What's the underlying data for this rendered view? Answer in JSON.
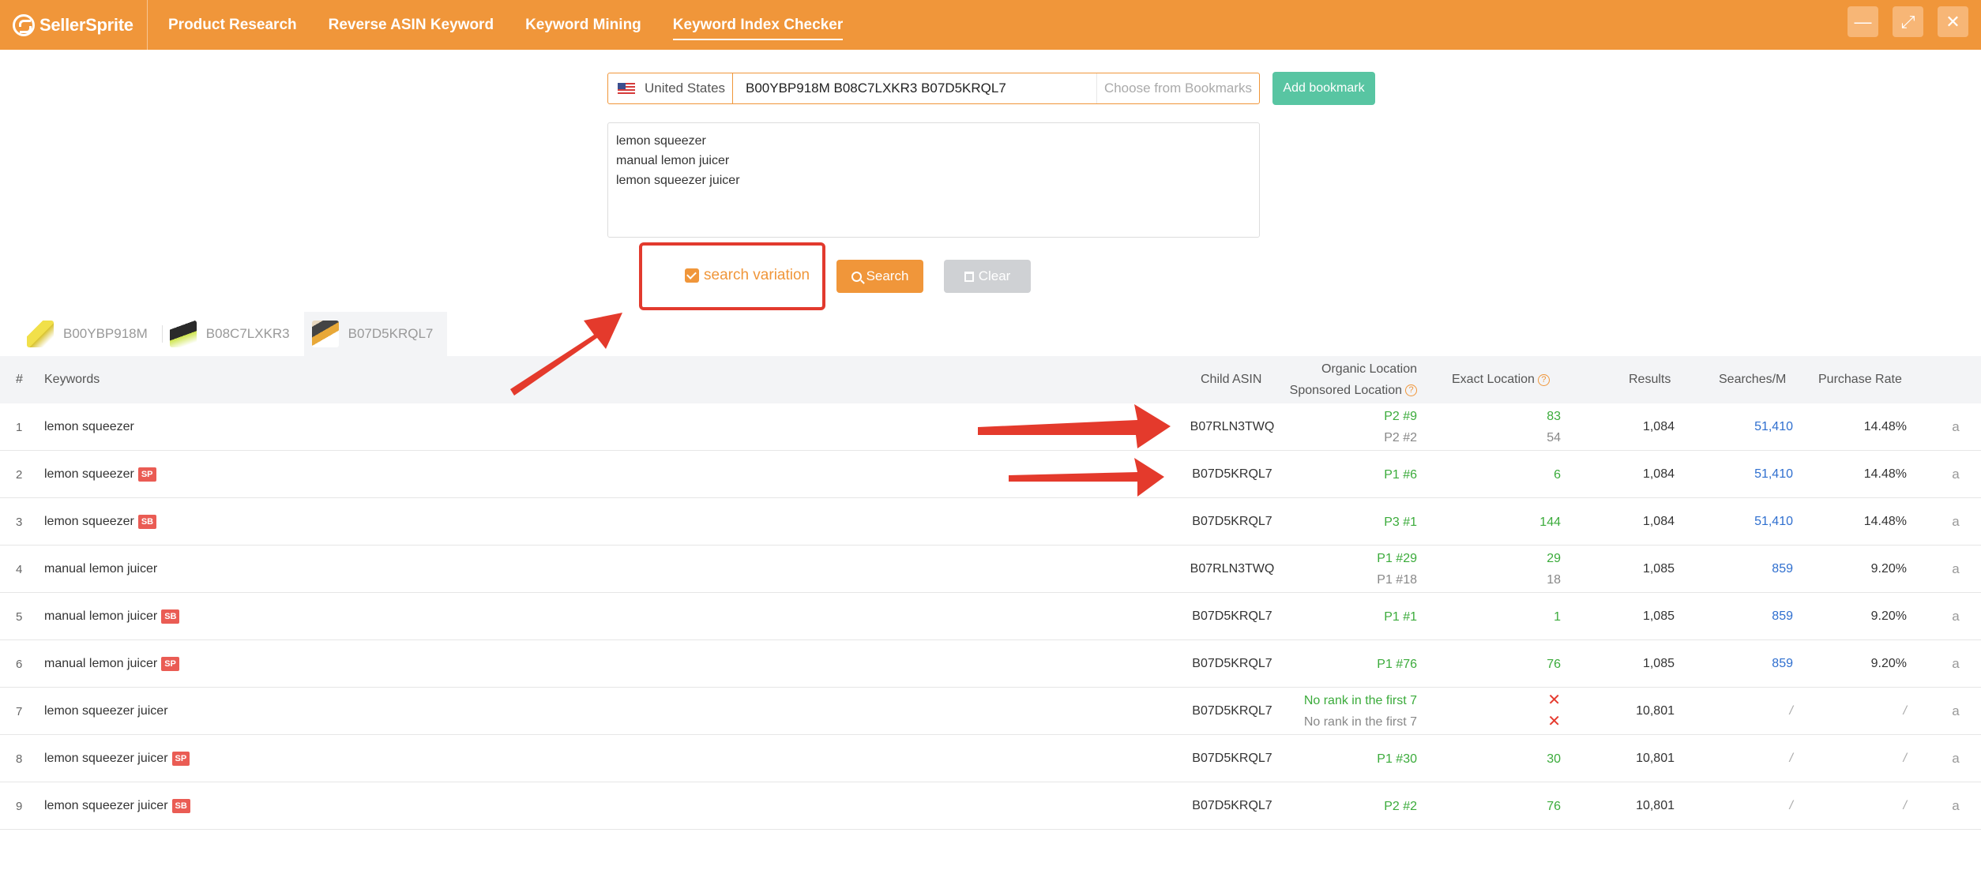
{
  "app": {
    "logo_text": "SellerSprite"
  },
  "nav": {
    "items": [
      "Product Research",
      "Reverse ASIN Keyword",
      "Keyword Mining",
      "Keyword Index Checker"
    ],
    "active_index": 3
  },
  "window_controls": {
    "minimize": "—",
    "maximize": "⤢",
    "close": "✕"
  },
  "search": {
    "country": "United States",
    "asins": "B00YBP918M B08C7LXKR3 B07D5KRQL7",
    "bookmark_placeholder": "Choose from Bookmarks",
    "add_bookmark_label": "Add bookmark",
    "keywords": [
      "lemon squeezer",
      "manual lemon juicer",
      "lemon squeezer juicer"
    ],
    "variation_label": "search variation",
    "variation_checked": true,
    "search_label": "Search",
    "clear_label": "Clear"
  },
  "asin_tabs": [
    {
      "label": "B00YBP918M",
      "active": false
    },
    {
      "label": "B08C7LXKR3",
      "active": false
    },
    {
      "label": "B07D5KRQL7",
      "active": true
    }
  ],
  "table": {
    "headers": {
      "num": "#",
      "keywords": "Keywords",
      "child_asin": "Child ASIN",
      "organic": "Organic Location",
      "sponsored": "Sponsored Location",
      "exact": "Exact Location",
      "results": "Results",
      "searches": "Searches/M",
      "purchase": "Purchase Rate"
    },
    "rows": [
      {
        "num": "1",
        "keyword": "lemon squeezer",
        "tag": "",
        "child": "B07RLN3TWQ",
        "org1": "P2 #9",
        "org2": "P2 #2",
        "ex1": "83",
        "ex2": "54",
        "results": "1,084",
        "searches": "51,410",
        "purchase": "14.48%"
      },
      {
        "num": "2",
        "keyword": "lemon squeezer",
        "tag": "SP",
        "child": "B07D5KRQL7",
        "org1": "P1 #6",
        "org2": "",
        "ex1": "6",
        "ex2": "",
        "results": "1,084",
        "searches": "51,410",
        "purchase": "14.48%"
      },
      {
        "num": "3",
        "keyword": "lemon squeezer",
        "tag": "SB",
        "child": "B07D5KRQL7",
        "org1": "P3 #1",
        "org2": "",
        "ex1": "144",
        "ex2": "",
        "results": "1,084",
        "searches": "51,410",
        "purchase": "14.48%"
      },
      {
        "num": "4",
        "keyword": "manual lemon juicer",
        "tag": "",
        "child": "B07RLN3TWQ",
        "org1": "P1 #29",
        "org2": "P1 #18",
        "ex1": "29",
        "ex2": "18",
        "results": "1,085",
        "searches": "859",
        "purchase": "9.20%"
      },
      {
        "num": "5",
        "keyword": "manual lemon juicer",
        "tag": "SB",
        "child": "B07D5KRQL7",
        "org1": "P1 #1",
        "org2": "",
        "ex1": "1",
        "ex2": "",
        "results": "1,085",
        "searches": "859",
        "purchase": "9.20%"
      },
      {
        "num": "6",
        "keyword": "manual lemon juicer",
        "tag": "SP",
        "child": "B07D5KRQL7",
        "org1": "P1 #76",
        "org2": "",
        "ex1": "76",
        "ex2": "",
        "results": "1,085",
        "searches": "859",
        "purchase": "9.20%"
      },
      {
        "num": "7",
        "keyword": "lemon squeezer juicer",
        "tag": "",
        "child": "B07D5KRQL7",
        "org1": "No rank in the first 7",
        "org2": "No rank in the first 7",
        "ex1": "✕",
        "ex2": "✕",
        "results": "10,801",
        "searches": "/",
        "purchase": "/"
      },
      {
        "num": "8",
        "keyword": "lemon squeezer juicer",
        "tag": "SP",
        "child": "B07D5KRQL7",
        "org1": "P1 #30",
        "org2": "",
        "ex1": "30",
        "ex2": "",
        "results": "10,801",
        "searches": "/",
        "purchase": "/"
      },
      {
        "num": "9",
        "keyword": "lemon squeezer juicer",
        "tag": "SB",
        "child": "B07D5KRQL7",
        "org1": "P2 #2",
        "org2": "",
        "ex1": "76",
        "ex2": "",
        "results": "10,801",
        "searches": "/",
        "purchase": "/"
      }
    ],
    "amazon_icon": "a"
  },
  "colors": {
    "brand": "#f0963a",
    "bookmark": "#58c5a2",
    "annotation": "#e23a2e",
    "positive": "#3bab3b",
    "link": "#2f6fcf"
  }
}
